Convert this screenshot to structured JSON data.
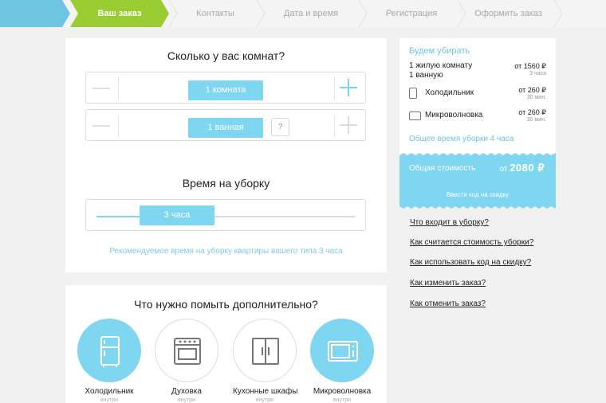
{
  "steps": [
    {
      "label": "",
      "state": "done"
    },
    {
      "label": "Ваш заказ",
      "state": "active"
    },
    {
      "label": "Контакты",
      "state": "pending"
    },
    {
      "label": "Дата и время",
      "state": "pending"
    },
    {
      "label": "Регистрация",
      "state": "pending"
    },
    {
      "label": "Оформить заказ",
      "state": "pending"
    }
  ],
  "rooms": {
    "title": "Сколько у вас комнат?",
    "rooms_value": "1 комната",
    "bath_value": "1 ванная",
    "help": "?"
  },
  "time": {
    "title": "Время на уборку",
    "value": "3 часа",
    "level_fraction": 0.15,
    "recommendation": "Рекомендуемое время на уборку квартиры вашего типа 3 часа"
  },
  "extras": {
    "title": "Что нужно помыть дополнительно?",
    "items": [
      {
        "label": "Холодильник",
        "sub": "внутри",
        "selected": true,
        "icon": "fridge-icon"
      },
      {
        "label": "Духовка",
        "sub": "внутри",
        "selected": false,
        "icon": "oven-icon"
      },
      {
        "label": "Кухонные шкафы",
        "sub": "внутри",
        "selected": false,
        "icon": "cabinet-icon"
      },
      {
        "label": "Микроволновка",
        "sub": "внутри",
        "selected": true,
        "icon": "microwave-icon"
      }
    ]
  },
  "summary": {
    "title": "Будем убирать",
    "line1a": "1 жилую комнату",
    "line1b": "1 ванную",
    "price1": "от 1560 ₽",
    "dur1": "3 часа",
    "item2": "Холодильник",
    "price2": "от 260 ₽",
    "dur2": "30 мин.",
    "item3": "Микроволновка",
    "price3": "от 260 ₽",
    "dur3": "30 мин.",
    "total_time": "Общее время уборки 4 часа"
  },
  "cost": {
    "label": "Общая стоимость",
    "prefix": "от",
    "value": "2080 ₽",
    "promo": "Ввести код на скидку"
  },
  "faq": [
    "Что входит в уборку?",
    "Как считается стоимость уборки?",
    "Как использовать код на скидку?",
    "Как изменить заказ?",
    "Как отменить заказ?"
  ],
  "colors": {
    "accent": "#7fd6f0",
    "active_step": "#9acd32",
    "done_step": "#6ec5e2"
  }
}
